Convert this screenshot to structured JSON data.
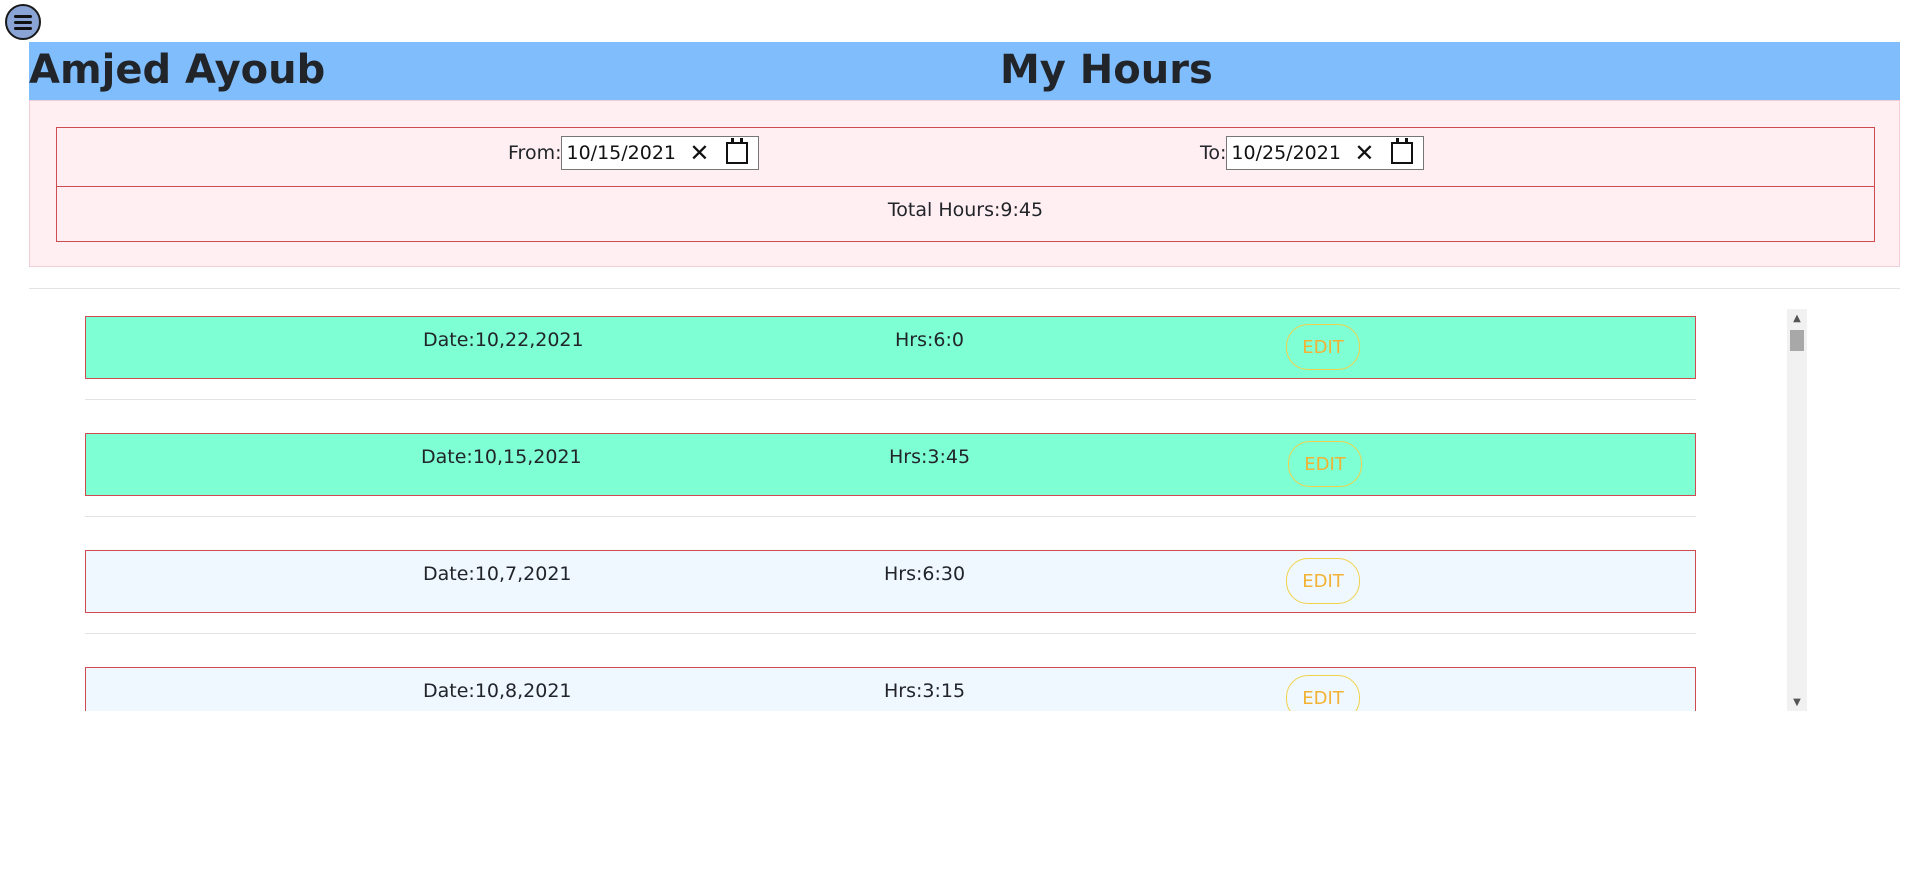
{
  "header": {
    "user_name": "Amjed Ayoub",
    "title": "My Hours"
  },
  "filter": {
    "from_label": "From:",
    "from_value": "10/15/2021",
    "to_label": "To:",
    "to_value": "10/25/2021",
    "total": "Total Hours:9:45"
  },
  "entries": [
    {
      "date": "Date:10,22,2021",
      "hours": "Hrs:6:0",
      "edit_label": "EDIT",
      "status": "green"
    },
    {
      "date": "Date:10,15,2021",
      "hours": "Hrs:3:45",
      "edit_label": "EDIT",
      "status": "green"
    },
    {
      "date": "Date:10,7,2021",
      "hours": "Hrs:6:30",
      "edit_label": "EDIT",
      "status": "blue"
    },
    {
      "date": "Date:10,8,2021",
      "hours": "Hrs:3:15",
      "edit_label": "EDIT",
      "status": "blue"
    }
  ],
  "colors": {
    "header_bg": "#80bdfd",
    "panel_bg": "#ffeef2",
    "row_green": "#7fffd4",
    "row_blue": "#f0f8ff",
    "row_border": "#cf4b52",
    "edit_text": "#f2b233"
  },
  "icons": {
    "menu": "hamburger-menu-icon",
    "clear": "clear-x-icon",
    "calendar": "calendar-icon"
  }
}
